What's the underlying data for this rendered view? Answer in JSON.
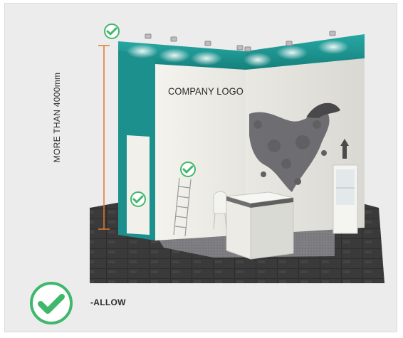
{
  "illustration": {
    "height_note": "MORE THAN 4000mm",
    "logo_text": "COMPANY LOGO"
  },
  "legend": {
    "label": "-ALLOW",
    "icon": "check-circle-icon",
    "check_color": "#3fb86b"
  },
  "colors": {
    "fascia": "#1f9a96",
    "wall": "#eeeee8",
    "floor": "#2b2b2b",
    "measure_line": "#e07a2e"
  }
}
